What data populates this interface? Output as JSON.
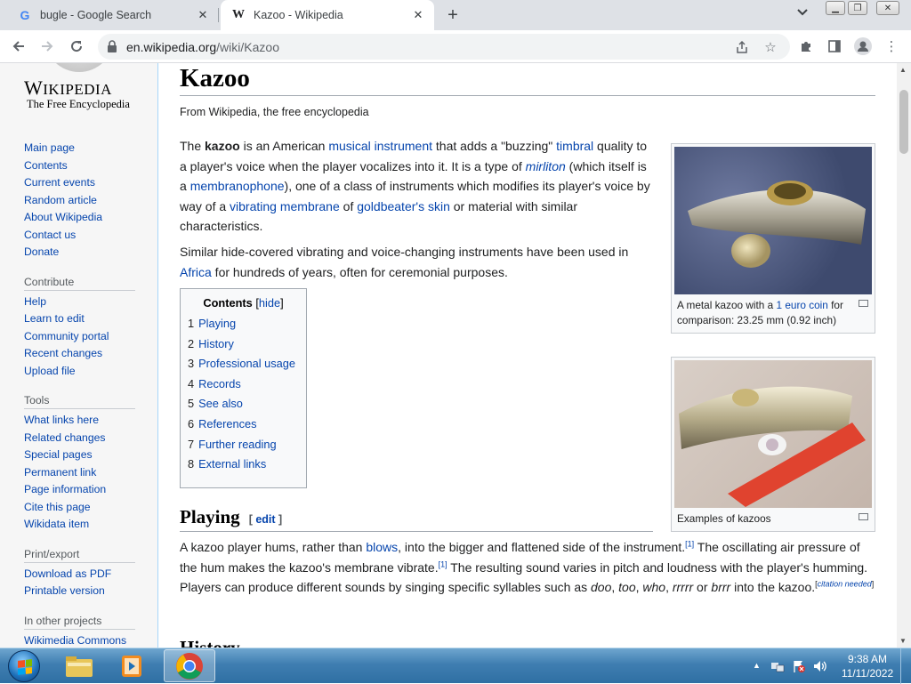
{
  "browser": {
    "tabs": [
      {
        "title": "bugle - Google Search",
        "favicon": "G",
        "active": false
      },
      {
        "title": "Kazoo - Wikipedia",
        "favicon": "W",
        "active": true
      }
    ],
    "url_domain": "en.wikipedia.org",
    "url_path": "/wiki/Kazoo"
  },
  "wiki": {
    "wordmark": "Wikipedia",
    "tagline": "The Free Encyclopedia",
    "nav": [
      "Main page",
      "Contents",
      "Current events",
      "Random article",
      "About Wikipedia",
      "Contact us",
      "Donate"
    ],
    "contribute_heading": "Contribute",
    "contribute": [
      "Help",
      "Learn to edit",
      "Community portal",
      "Recent changes",
      "Upload file"
    ],
    "tools_heading": "Tools",
    "tools": [
      "What links here",
      "Related changes",
      "Special pages",
      "Permanent link",
      "Page information",
      "Cite this page",
      "Wikidata item"
    ],
    "print_heading": "Print/export",
    "print": [
      "Download as PDF",
      "Printable version"
    ],
    "other_heading": "In other projects",
    "other": [
      "Wikimedia Commons"
    ]
  },
  "article": {
    "title": "Kazoo",
    "from": "From Wikipedia, the free encyclopedia",
    "p1": {
      "t1": "The ",
      "b": "kazoo",
      "t2": " is an American ",
      "l1": "musical instrument",
      "t3": " that adds a \"buzzing\" ",
      "l2": "timbral",
      "t4": " quality to a player's voice when the player vocalizes into it. It is a type of ",
      "l3": "mirliton",
      "t5": " (which itself is a ",
      "l4": "membranophone",
      "t6": "), one of a class of instruments which modifies its player's voice by way of a ",
      "l5": "vibrating membrane",
      "t7": " of ",
      "l6": "goldbeater's skin",
      "t8": " or material with similar characteristics."
    },
    "p2": {
      "t1": "Similar hide-covered vibrating and voice-changing instruments have been used in ",
      "l1": "Africa",
      "t2": " for hundreds of years, often for ceremonial purposes."
    },
    "toc": {
      "title": "Contents",
      "hide": "hide",
      "items": [
        {
          "num": "1",
          "label": "Playing"
        },
        {
          "num": "2",
          "label": "History"
        },
        {
          "num": "3",
          "label": "Professional usage"
        },
        {
          "num": "4",
          "label": "Records"
        },
        {
          "num": "5",
          "label": "See also"
        },
        {
          "num": "6",
          "label": "References"
        },
        {
          "num": "7",
          "label": "Further reading"
        },
        {
          "num": "8",
          "label": "External links"
        }
      ]
    },
    "image1_caption": {
      "t1": "A metal kazoo with a ",
      "l1": "1 euro coin",
      "t2": " for comparison: 23.25 mm (0.92 inch)"
    },
    "image2_caption": "Examples of kazoos",
    "playing_heading": "Playing",
    "edit_label": "edit",
    "p3": {
      "t1": "A kazoo player hums, rather than ",
      "l1": "blows",
      "t2": ", into the bigger and flattened side of the instrument.",
      "ref1": "[1]",
      "t3": " The oscillating air pressure of the hum makes the kazoo's membrane vibrate.",
      "ref2": "[1]",
      "t4": " The resulting sound varies in pitch and loudness with the player's humming. Players can produce different sounds by singing specific syllables such as ",
      "i1": "doo",
      "t5": ", ",
      "i2": "too",
      "t6": ", ",
      "i3": "who",
      "t7": ", ",
      "i4": "rrrrr",
      "t8": " or ",
      "i5": "brrr",
      "t9": " into the kazoo.",
      "cite": "citation needed"
    },
    "history_heading": "History"
  },
  "taskbar": {
    "time": "9:38 AM",
    "date": "11/11/2022"
  }
}
